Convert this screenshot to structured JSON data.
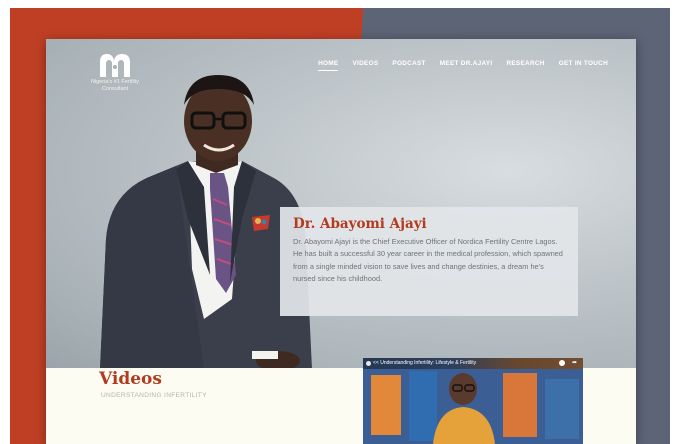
{
  "logo": {
    "tagline": "Nigeria's #1 Fertility Consultant"
  },
  "nav": {
    "items": [
      "HOME",
      "VIDEOS",
      "PODCAST",
      "MEET DR.AJAYI",
      "RESEARCH",
      "GET IN TOUCH"
    ],
    "active": "HOME"
  },
  "hero": {
    "name": "Dr. Abayomi Ajayi",
    "bio": "Dr. Abayomi Ajayi is the Chief Executive Officer of Nordica Fertility Centre Lagos. He has built a successful 30 year career in the medical profession, which spawned from a single minded vision to save lives and change destinies, a dream he’s nursed since his childhood."
  },
  "videos": {
    "title": "Videos",
    "subtitle": "UNDERSTANDING INFERTILITY",
    "thumbnail_title": "<< Understanding Infertility: Lifestyle & Fertility"
  },
  "colors": {
    "accent": "#b33a1e",
    "background_left": "#bf3f24",
    "background_right": "#5c6475"
  }
}
